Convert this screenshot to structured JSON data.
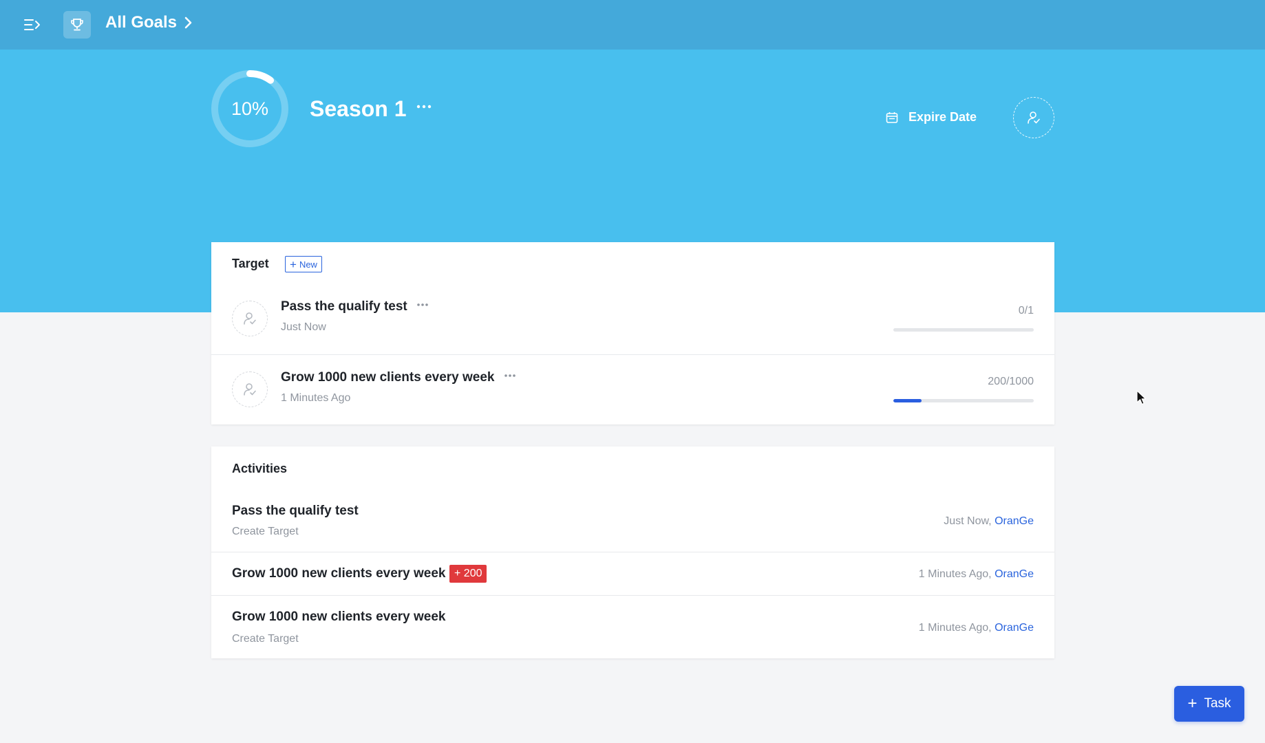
{
  "header": {
    "breadcrumb": "All Goals",
    "icons": [
      "menu-collapse-icon",
      "trophy-icon",
      "chevron-right-icon"
    ]
  },
  "goal": {
    "progress_label": "10%",
    "progress": 0.1,
    "title": "Season 1",
    "expire_label": "Expire Date",
    "icons": [
      "more-icon",
      "calendar-icon",
      "assign-user-icon"
    ]
  },
  "targets": {
    "title": "Target",
    "new_label": "New",
    "items": [
      {
        "name": "Pass the qualify test",
        "time": "Just Now",
        "count": "0/1",
        "progress": 0
      },
      {
        "name": "Grow 1000 new clients every week",
        "time": "1 Minutes Ago",
        "count": "200/1000",
        "progress": 0.2
      }
    ]
  },
  "activities": {
    "title": "Activities",
    "items": [
      {
        "name": "Pass the qualify test",
        "sub": "Create Target",
        "time": "Just Now, ",
        "user": "OranGe"
      },
      {
        "name": "Grow 1000 new clients every week",
        "badge": "+ 200",
        "time": "1 Minutes Ago, ",
        "user": "OranGe"
      },
      {
        "name": "Grow 1000 new clients every week",
        "sub": "Create Target",
        "time": "1 Minutes Ago, ",
        "user": "OranGe"
      }
    ]
  },
  "fab": {
    "label": "Task"
  },
  "colors": {
    "topbar": "#44a9da",
    "hero": "#48bfee",
    "accent": "#2a5ee0",
    "badge": "#e0393c"
  }
}
